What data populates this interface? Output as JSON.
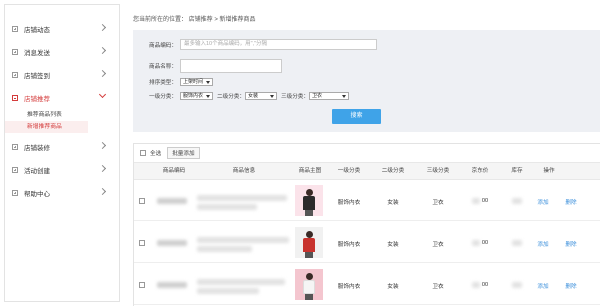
{
  "sidebar": {
    "items": [
      {
        "label": "店铺动态"
      },
      {
        "label": "消息发送"
      },
      {
        "label": "店铺签到"
      },
      {
        "label": "店铺推荐"
      },
      {
        "label": "店铺装修"
      },
      {
        "label": "活动创建"
      },
      {
        "label": "帮助中心"
      }
    ],
    "subitems": [
      {
        "label": "推荐商品列表"
      },
      {
        "label": "新增推荐商品"
      }
    ]
  },
  "breadcrumb": "您当前所在的位置： 店铺推荐 > 新增推荐商品",
  "filter": {
    "code_label": "商品编码：",
    "code_placeholder": "最多输入10个商品编码，用\",\"分隔",
    "name_label": "商品名称：",
    "sort_label": "排序类型：",
    "sort_value": "上架时间",
    "cat1_label": "一级分类：",
    "cat1_value": "服饰内衣",
    "cat2_label": "二级分类：",
    "cat2_value": "女装",
    "cat3_label": "三级分类：",
    "cat3_value": "卫衣",
    "search_button": "搜索"
  },
  "table": {
    "select_all": "全选",
    "batch_add": "批量添加",
    "headers": [
      "商品编码",
      "商品信息",
      "商品主图",
      "一级分类",
      "二级分类",
      "三级分类",
      "京东价",
      "库存",
      "操作"
    ],
    "rows": [
      {
        "cat1": "服饰内衣",
        "cat2": "女装",
        "cat3": "卫衣",
        "price": "00",
        "add": "添加",
        "delete": "删除"
      },
      {
        "cat1": "服饰内衣",
        "cat2": "女装",
        "cat3": "卫衣",
        "price": "00",
        "add": "添加",
        "delete": "删除"
      },
      {
        "cat1": "服饰内衣",
        "cat2": "女装",
        "cat3": "卫衣",
        "price": "00",
        "add": "添加",
        "delete": "删除"
      }
    ]
  },
  "colors": {
    "accent_red": "#d43c3c",
    "button_blue": "#3fa3e8",
    "link_blue": "#3b8fdb",
    "filter_bg": "#eef0f4"
  }
}
